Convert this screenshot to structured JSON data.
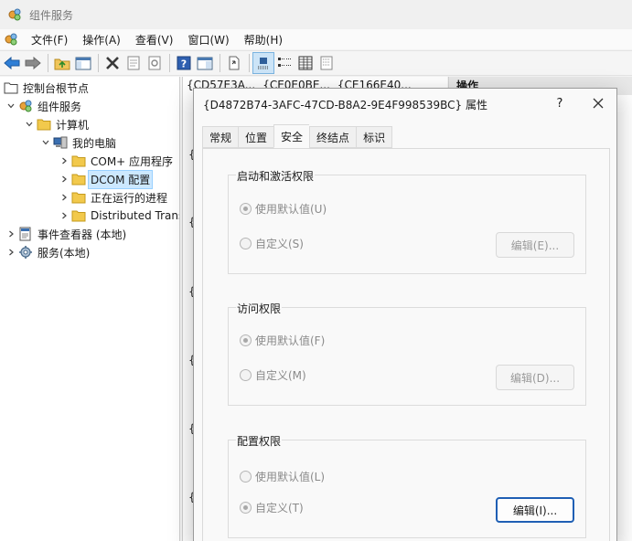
{
  "window": {
    "title": "组件服务"
  },
  "menu": [
    "文件(F)",
    "操作(A)",
    "查看(V)",
    "窗口(W)",
    "帮助(H)"
  ],
  "toolbar": [
    "back-icon",
    "forward-icon",
    "folder-up-icon",
    "console-tree-icon",
    "delete-icon",
    "properties-icon",
    "refresh-icon",
    "help-icon",
    "mmc-icon",
    "export-icon",
    "large-icons-icon",
    "small-icons-icon",
    "list-view-icon",
    "detail-view-icon"
  ],
  "tree": {
    "root": "控制台根节点",
    "component_services": "组件服务",
    "computers": "计算机",
    "my_computer": "我的电脑",
    "com_apps": "COM+ 应用程序",
    "dcom": "DCOM 配置",
    "running": "正在运行的进程",
    "dtc": "Distributed Transaction Coordinator",
    "event_viewer": "事件查看器 (本地)",
    "services": "服务(本地)"
  },
  "list": {
    "columns": [
      "{CD57E3A...",
      "{CE0E0BE...",
      "{CE166E40..."
    ],
    "items": [
      "{",
      "{I",
      "{E",
      "{",
      "{I",
      "{F"
    ]
  },
  "actions": {
    "header": "操作"
  },
  "dialog": {
    "title": "{D4872B74-3AFC-47CD-B8A2-9E4F998539BC} 属性",
    "help": "?",
    "tabs": [
      "常规",
      "位置",
      "安全",
      "终结点",
      "标识"
    ],
    "launch": {
      "title": "启动和激活权限",
      "default": "使用默认值(U)",
      "custom": "自定义(S)",
      "edit": "编辑(E)..."
    },
    "access": {
      "title": "访问权限",
      "default": "使用默认值(F)",
      "custom": "自定义(M)",
      "edit": "编辑(D)..."
    },
    "config": {
      "title": "配置权限",
      "default": "使用默认值(L)",
      "custom": "自定义(T)",
      "edit": "编辑(I)..."
    }
  }
}
